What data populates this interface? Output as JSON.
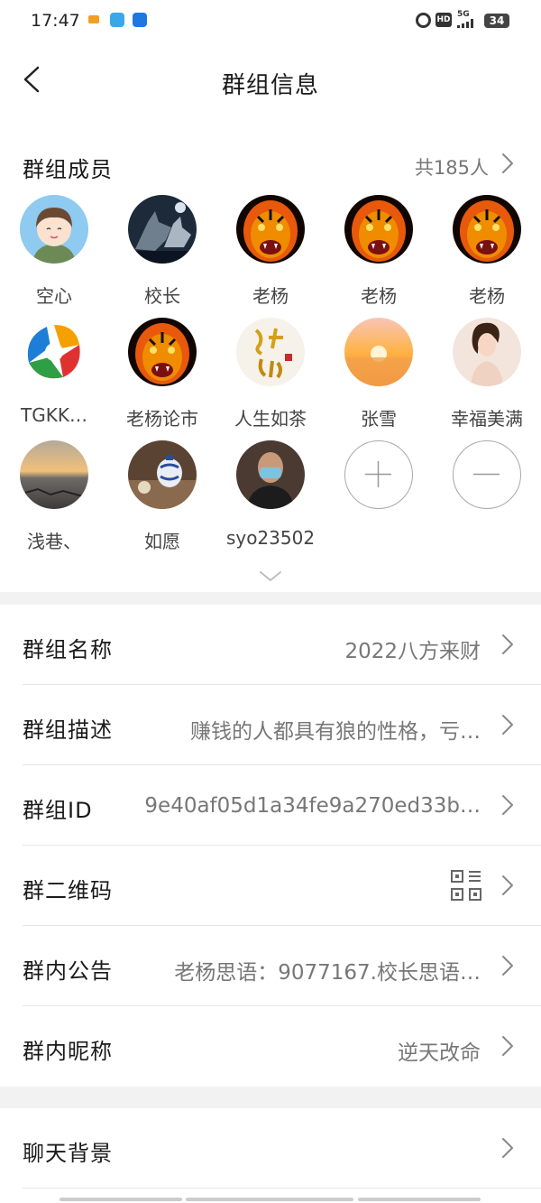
{
  "status": {
    "time": "17:47",
    "network": "5G",
    "hd": "HD",
    "battery": "34"
  },
  "header": {
    "title": "群组信息"
  },
  "members": {
    "label": "群组成员",
    "count": "共185人",
    "items": [
      {
        "name": "空心",
        "avatar": "cartoon-boy"
      },
      {
        "name": "校长",
        "avatar": "wolf"
      },
      {
        "name": "老杨",
        "avatar": "tiger"
      },
      {
        "name": "老杨",
        "avatar": "tiger"
      },
      {
        "name": "老杨",
        "avatar": "tiger"
      },
      {
        "name": "TGKK…",
        "avatar": "logo"
      },
      {
        "name": "老杨论市",
        "avatar": "tiger"
      },
      {
        "name": "人生如茶",
        "avatar": "calligraphy"
      },
      {
        "name": "张雪",
        "avatar": "sunset"
      },
      {
        "name": "幸福美满",
        "avatar": "woman"
      },
      {
        "name": "浅巷、",
        "avatar": "sea-sunset"
      },
      {
        "name": "如愿",
        "avatar": "teapot"
      },
      {
        "name": "syo23502",
        "avatar": "man-mask"
      }
    ]
  },
  "info": {
    "name": {
      "label": "群组名称",
      "value": "2022八方来财"
    },
    "description": {
      "label": "群组描述",
      "value": "赚钱的人都具有狼的性格，亏…"
    },
    "group_id": {
      "label": "群组ID",
      "value": "9e40af05d1a34fe9a270ed33b…"
    },
    "qr": {
      "label": "群二维码"
    },
    "notice": {
      "label": "群内公告",
      "value": "老杨思语：9077167.校长思语…"
    },
    "nickname": {
      "label": "群内昵称",
      "value": "逆天改命"
    }
  },
  "background": {
    "label": "聊天背景"
  },
  "colors": {
    "page_bg": "#f2f2f2",
    "card_bg": "#ffffff",
    "secondary_text": "#777777"
  }
}
